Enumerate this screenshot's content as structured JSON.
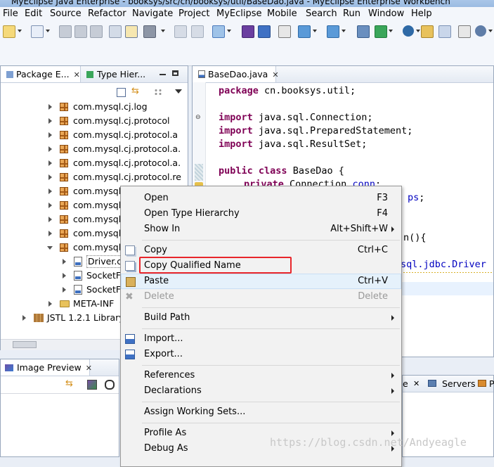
{
  "window": {
    "title": "MyEclipse Java Enterprise - booksys/src/cn/booksys/util/BaseDao.java - MyEclipse Enterprise Workbench"
  },
  "menubar": {
    "items": [
      "File",
      "Edit",
      "Source",
      "Refactor",
      "Navigate",
      "Project",
      "MyEclipse",
      "Mobile",
      "Search",
      "Run",
      "Window",
      "Help"
    ]
  },
  "package_explorer": {
    "tabs": [
      {
        "label": "Package E..."
      },
      {
        "label": "Type Hier..."
      }
    ],
    "tree": [
      {
        "label": "com.mysql.cj.log",
        "type": "package"
      },
      {
        "label": "com.mysql.cj.protocol",
        "type": "package"
      },
      {
        "label": "com.mysql.cj.protocol.a",
        "type": "package"
      },
      {
        "label": "com.mysql.cj.protocol.a.",
        "type": "package"
      },
      {
        "label": "com.mysql.cj.protocol.a.",
        "type": "package"
      },
      {
        "label": "com.mysql.cj.protocol.re",
        "type": "package"
      },
      {
        "label": "com.mysql.",
        "type": "package"
      },
      {
        "label": "com.mysql.",
        "type": "package"
      },
      {
        "label": "com.mysql.",
        "type": "package"
      },
      {
        "label": "com.mysql.",
        "type": "package"
      },
      {
        "label": "com.mysql.",
        "type": "package"
      },
      {
        "label": "Driver.cl",
        "type": "class"
      },
      {
        "label": "SocketFa",
        "type": "class"
      },
      {
        "label": "SocketFa",
        "type": "class"
      },
      {
        "label": "META-INF",
        "type": "folder"
      },
      {
        "label": "JSTL 1.2.1 Library",
        "type": "library"
      }
    ]
  },
  "editor": {
    "tab_label": "BaseDao.java",
    "code": {
      "l1_kw": "package",
      "l1_rest": " cn.booksys.util;",
      "l3_kw": "import",
      "l3_rest": " java.sql.Connection;",
      "l4_kw": "import",
      "l4_rest": " java.sql.PreparedStatement;",
      "l5_kw": "import",
      "l5_rest": " java.sql.ResultSet;",
      "l7_kw1": "public",
      "l7_kw2": "class",
      "l7_rest": " BaseDao {",
      "l8_kw": "private",
      "l8_rest": " Connection ",
      "l8_field": "conn",
      "l8_end": ";",
      "l9_field": "ps",
      "l9_end": ";",
      "l11_frag": "n(){",
      "l12_frag": "sql.jdbc.Driver"
    }
  },
  "context_menu": {
    "items": [
      {
        "label": "Open",
        "accel": "F3"
      },
      {
        "label": "Open Type Hierarchy",
        "accel": "F4"
      },
      {
        "label": "Show In",
        "accel": "Alt+Shift+W"
      },
      {
        "label": "Copy",
        "accel": "Ctrl+C"
      },
      {
        "label": "Copy Qualified Name",
        "accel": ""
      },
      {
        "label": "Paste",
        "accel": "Ctrl+V"
      },
      {
        "label": "Delete",
        "accel": "Delete"
      },
      {
        "label": "Build Path",
        "accel": ""
      },
      {
        "label": "Import...",
        "accel": ""
      },
      {
        "label": "Export...",
        "accel": ""
      },
      {
        "label": "References",
        "accel": ""
      },
      {
        "label": "Declarations",
        "accel": ""
      },
      {
        "label": "Assign Working Sets...",
        "accel": ""
      },
      {
        "label": "Profile As",
        "accel": ""
      },
      {
        "label": "Debug As",
        "accel": ""
      }
    ]
  },
  "bottom_panels": {
    "image_preview_label": "Image Preview",
    "right_tab1": "e",
    "servers_label": "Servers",
    "right_tab3": "P"
  },
  "watermark": "https://blog.csdn.net/Andyeagle",
  "colors": {
    "highlight_box": "#e8262b",
    "keyword": "#7f0055",
    "field": "#0000c0",
    "menu_hover": "#e5f1fb"
  }
}
